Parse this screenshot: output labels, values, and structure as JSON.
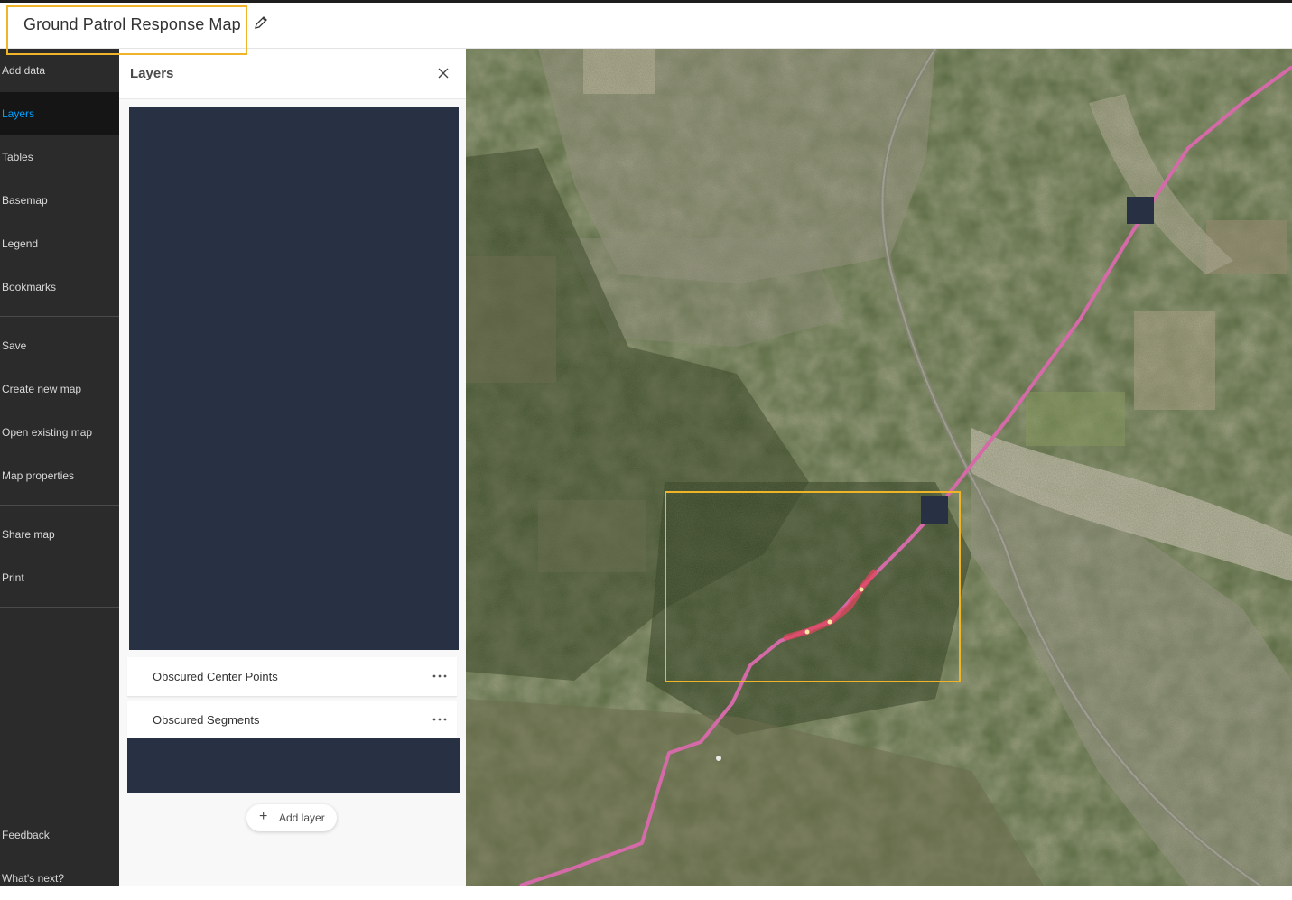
{
  "header": {
    "map_title": "Ground Patrol Response Map"
  },
  "sidebar": {
    "items": [
      {
        "label": "Add data",
        "active": false
      },
      {
        "label": "Layers",
        "active": true
      },
      {
        "label": "Tables",
        "active": false
      },
      {
        "label": "Basemap",
        "active": false
      },
      {
        "label": "Legend",
        "active": false
      },
      {
        "label": "Bookmarks",
        "active": false
      },
      {
        "label": "Save",
        "active": false
      },
      {
        "label": "Create new map",
        "active": false
      },
      {
        "label": "Open existing map",
        "active": false
      },
      {
        "label": "Map properties",
        "active": false
      },
      {
        "label": "Share map",
        "active": false
      },
      {
        "label": "Print",
        "active": false
      },
      {
        "label": "Feedback",
        "active": false
      },
      {
        "label": "What's next?",
        "active": false
      }
    ]
  },
  "layers_panel": {
    "title": "Layers",
    "layers": [
      {
        "name": "Obscured Center Points"
      },
      {
        "name": "Obscured Segments"
      }
    ],
    "add_layer_label": "Add layer"
  },
  "colors": {
    "accent": "#00a0ff",
    "highlight_box": "#f0b429",
    "redaction": "#283043",
    "route_line": "#d46aa8",
    "route_highlight": "#e0465e"
  },
  "icons": {
    "edit": "pencil-icon",
    "close": "close-icon",
    "more": "ellipsis-icon",
    "add": "plus-icon"
  }
}
